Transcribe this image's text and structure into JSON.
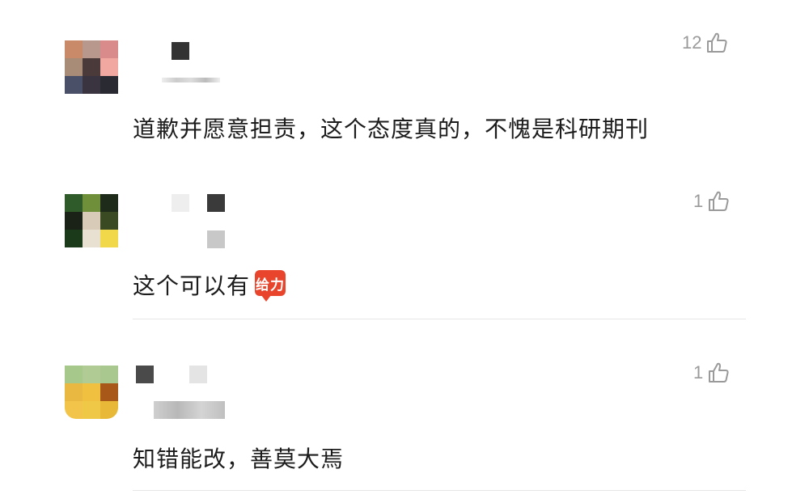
{
  "comments": [
    {
      "likes": "12",
      "text": "道歉并愿意担责，这个态度真的，不愧是科研期刊",
      "avatar_colors": [
        "#c98a6a",
        "#b8988c",
        "#d98a8a",
        "#a88c78",
        "#4a3a3a",
        "#f0a8a0",
        "#4a5068",
        "#3a3440",
        "#2a2a32"
      ]
    },
    {
      "likes": "1",
      "text": "这个可以有",
      "emoticon_label": "给力",
      "avatar_colors": [
        "#2f5a2a",
        "#6f8f3a",
        "#1e2a1a",
        "#1a2218",
        "#d8ccb8",
        "#3a4a22",
        "#1a3a1a",
        "#e8e0d0",
        "#f0d84a"
      ]
    },
    {
      "likes": "1",
      "text": "知错能改，善莫大焉",
      "avatar_colors": [
        "#a6c88a",
        "#b0cc94",
        "#a8c890",
        "#e8b840",
        "#f0c040",
        "#a85818",
        "#f2c44a",
        "#f0c848",
        "#e8b838"
      ]
    }
  ],
  "icons": {
    "like": "thumbs-up-icon",
    "emoticon": "geili-emoticon-icon"
  },
  "colors": {
    "text": "#1c1c1c",
    "like": "#9a9a9a",
    "divider": "#e6e6e6",
    "emoticon": "#e8452c"
  }
}
